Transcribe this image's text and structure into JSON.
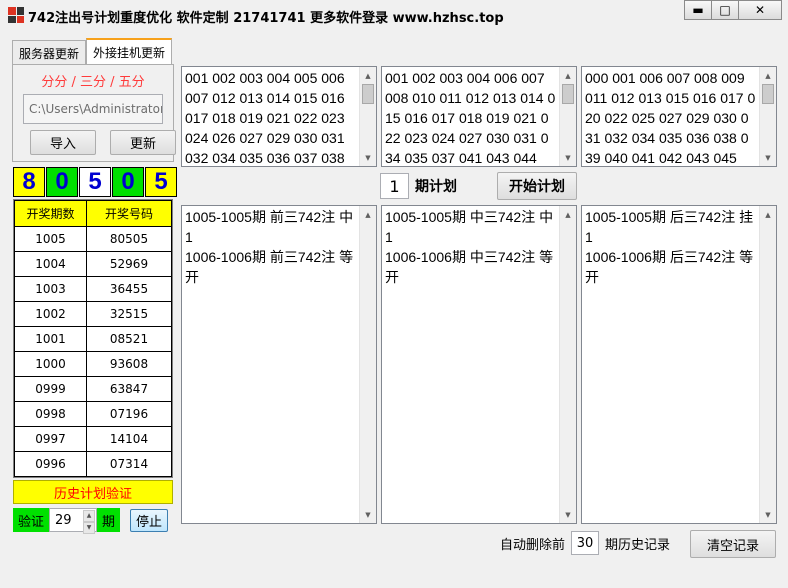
{
  "window": {
    "title": "742注出号计划重度优化 软件定制 21741741 更多软件登录 www.hzhsc.top",
    "minimize_label": "▬",
    "maximize_label": "□",
    "close_label": "✕"
  },
  "tabs": [
    {
      "label": "服务器更新"
    },
    {
      "label": "外接挂机更新"
    }
  ],
  "tab_panel": {
    "subtitle": "分分 / 三分 / 五分",
    "path_value": "C:\\Users\\Administrator\\",
    "import_label": "导入",
    "update_label": "更新"
  },
  "latest_digits": [
    "8",
    "0",
    "5",
    "0",
    "5"
  ],
  "history": {
    "headers": [
      "开奖期数",
      "开奖号码"
    ],
    "rows": [
      [
        "1005",
        "80505"
      ],
      [
        "1004",
        "52969"
      ],
      [
        "1003",
        "36455"
      ],
      [
        "1002",
        "32515"
      ],
      [
        "1001",
        "08521"
      ],
      [
        "1000",
        "93608"
      ],
      [
        "0999",
        "63847"
      ],
      [
        "0998",
        "07196"
      ],
      [
        "0997",
        "14104"
      ],
      [
        "0996",
        "07314"
      ]
    ]
  },
  "verify": {
    "bar_label": "历史计划验证",
    "prefix_label": "验证",
    "value": "29",
    "suffix_label": "期",
    "stop_label": "停止"
  },
  "number_lists": [
    "001 002 003 004 005 006 007 012 013 014 015 016 017 018 019 021 022 023 024 026 027 029 030 031 032 034 035 036 037 038",
    "001 002 003 004 006 007 008 010 011 012 013 014 015 016 017 018 019 021 022 023 024 027 030 031 034 035 037 041 043 044",
    "000 001 006 007 008 009 011 012 013 015 016 017 020 022 025 027 029 030 031 032 034 035 036 038 039 040 041 042 043 045"
  ],
  "plan": {
    "periods_value": "1",
    "periods_label": "期计划",
    "start_label": "开始计划"
  },
  "results": [
    "1005-1005期 前三742注 中1\n1006-1006期 前三742注 等开",
    "1005-1005期 中三742注 中1\n1006-1006期 中三742注 等开",
    "1005-1005期 后三742注 挂1\n1006-1006期 后三742注 等开"
  ],
  "footer": {
    "auto_delete_label": "自动删除前",
    "auto_delete_value": "30",
    "history_label": "期历史记录",
    "clear_label": "清空记录"
  }
}
